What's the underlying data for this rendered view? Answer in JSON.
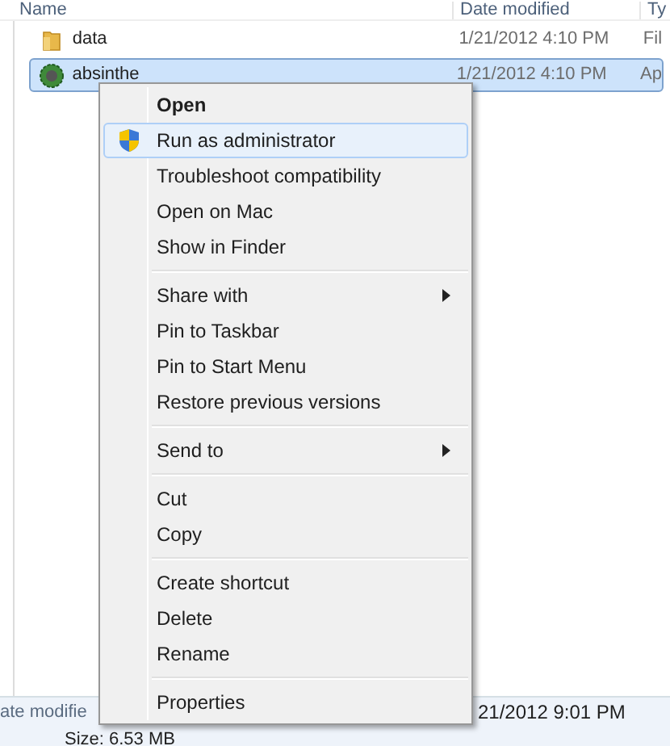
{
  "columns": [
    "Name",
    "Date modified",
    "Ty"
  ],
  "files": [
    {
      "kind": "folder",
      "name": "data",
      "date": "1/21/2012 4:10 PM",
      "type": "Fil",
      "selected": false
    },
    {
      "kind": "app",
      "name": "absinthe",
      "date": "1/21/2012 4:10 PM",
      "type": "Ap",
      "selected": true
    }
  ],
  "context_menu": [
    {
      "kind": "default",
      "label": "Open",
      "selected": false
    },
    {
      "kind": "shield",
      "label": "Run as administrator",
      "selected": true
    },
    {
      "kind": "plain",
      "label": "Troubleshoot compatibility",
      "selected": false
    },
    {
      "kind": "plain",
      "label": "Open on Mac",
      "selected": false
    },
    {
      "kind": "plain",
      "label": "Show in Finder",
      "selected": false
    },
    {
      "kind": "separator"
    },
    {
      "kind": "submenu",
      "label": "Share with",
      "selected": false
    },
    {
      "kind": "plain",
      "label": "Pin to Taskbar",
      "selected": false
    },
    {
      "kind": "plain",
      "label": "Pin to Start Menu",
      "selected": false
    },
    {
      "kind": "plain",
      "label": "Restore previous versions",
      "selected": false
    },
    {
      "kind": "separator"
    },
    {
      "kind": "submenu",
      "label": "Send to",
      "selected": false
    },
    {
      "kind": "separator"
    },
    {
      "kind": "plain",
      "label": "Cut",
      "selected": false
    },
    {
      "kind": "plain",
      "label": "Copy",
      "selected": false
    },
    {
      "kind": "separator"
    },
    {
      "kind": "plain",
      "label": "Create shortcut",
      "selected": false
    },
    {
      "kind": "plain",
      "label": "Delete",
      "selected": false
    },
    {
      "kind": "plain",
      "label": "Rename",
      "selected": false
    },
    {
      "kind": "separator"
    },
    {
      "kind": "plain",
      "label": "Properties",
      "selected": false
    }
  ],
  "details": {
    "modified_label": "ate modifie",
    "modified_value": "21/2012 9:01 PM",
    "size": "Size: 6.53 MB"
  }
}
